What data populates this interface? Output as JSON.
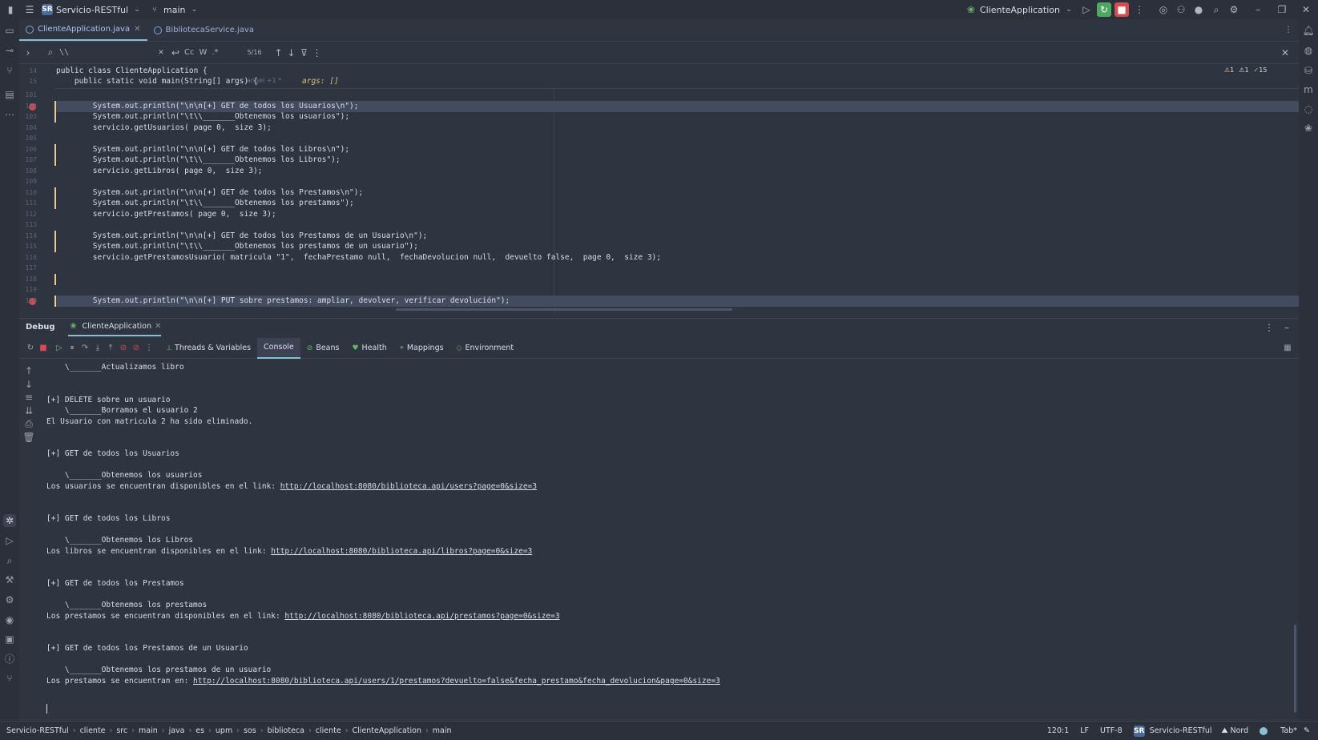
{
  "titlebar": {
    "project_badge": "SR",
    "project_name": "Servicio-RESTful",
    "branch": "main",
    "run_config": "ClienteApplication"
  },
  "tabs": [
    {
      "label": "ClienteApplication.java",
      "active": true
    },
    {
      "label": "BibliotecaService.java",
      "active": false
    }
  ],
  "search": {
    "query": "\\\\",
    "match_case": "Cc",
    "words": "W",
    "regex": ".*",
    "counter": "5/16"
  },
  "inspections": {
    "warnings": "1",
    "weak_warnings": "1",
    "ok": "15"
  },
  "editor": {
    "header_lines": [
      {
        "num": "14",
        "text": "public class ClienteApplication {"
      },
      {
        "num": "15",
        "text": "    public static void main(String[] args) {",
        "author": "angel +1 *",
        "hint": "args: []"
      }
    ],
    "lines": [
      {
        "num": "101",
        "text": ""
      },
      {
        "num": "102",
        "text": "        System.out.println(\"\\n\\n[+] GET de todos los Usuarios\\n\");",
        "bp": true,
        "highlight": true,
        "changed": true
      },
      {
        "num": "103",
        "text": "        System.out.println(\"\\t\\\\_______Obtenemos los usuarios\");",
        "changed": true
      },
      {
        "num": "104",
        "text": "        servicio.getUsuarios( page 0,  size 3);"
      },
      {
        "num": "105",
        "text": ""
      },
      {
        "num": "106",
        "text": "        System.out.println(\"\\n\\n[+] GET de todos los Libros\\n\");",
        "changed": true
      },
      {
        "num": "107",
        "text": "        System.out.println(\"\\t\\\\_______Obtenemos los Libros\");",
        "changed": true
      },
      {
        "num": "108",
        "text": "        servicio.getLibros( page 0,  size 3);"
      },
      {
        "num": "109",
        "text": ""
      },
      {
        "num": "110",
        "text": "        System.out.println(\"\\n\\n[+] GET de todos los Prestamos\\n\");",
        "changed": true
      },
      {
        "num": "111",
        "text": "        System.out.println(\"\\t\\\\_______Obtenemos los prestamos\");",
        "changed": true
      },
      {
        "num": "112",
        "text": "        servicio.getPrestamos( page 0,  size 3);"
      },
      {
        "num": "113",
        "text": ""
      },
      {
        "num": "114",
        "text": "        System.out.println(\"\\n\\n[+] GET de todos los Prestamos de un Usuario\\n\");",
        "changed": true
      },
      {
        "num": "115",
        "text": "        System.out.println(\"\\t\\\\_______Obtenemos los prestamos de un usuario\");",
        "changed": true
      },
      {
        "num": "116",
        "text": "        servicio.getPrestamosUsuario( matricula \"1\",  fechaPrestamo null,  fechaDevolucion null,  devuelto false,  page 0,  size 3);"
      },
      {
        "num": "117",
        "text": ""
      },
      {
        "num": "118",
        "text": "",
        "changed": true
      },
      {
        "num": "119",
        "text": ""
      },
      {
        "num": "120",
        "text": "        System.out.println(\"\\n\\n[+] PUT sobre prestamos: ampliar, devolver, verificar devolución\");",
        "bp": true,
        "highlight": true,
        "changed": true
      }
    ]
  },
  "debug": {
    "title": "Debug",
    "session": "ClienteApplication",
    "tabs": [
      "Threads & Variables",
      "Console",
      "Beans",
      "Health",
      "Mappings",
      "Environment"
    ],
    "active_tab": "Console"
  },
  "console": {
    "lines": [
      {
        "text": "    \\_______Actualizamos libro"
      },
      {
        "text": ""
      },
      {
        "text": ""
      },
      {
        "text": "[+] DELETE sobre un usuario"
      },
      {
        "text": "    \\_______Borramos el usuario 2"
      },
      {
        "text": "El Usuario con matricula 2 ha sido eliminado."
      },
      {
        "text": ""
      },
      {
        "text": ""
      },
      {
        "text": "[+] GET de todos los Usuarios"
      },
      {
        "text": ""
      },
      {
        "text": "    \\_______Obtenemos los usuarios"
      },
      {
        "text": "Los usuarios se encuentran disponibles en el link: ",
        "link": "http://localhost:8080/biblioteca.api/users?page=0&size=3"
      },
      {
        "text": ""
      },
      {
        "text": ""
      },
      {
        "text": "[+] GET de todos los Libros"
      },
      {
        "text": ""
      },
      {
        "text": "    \\_______Obtenemos los Libros"
      },
      {
        "text": "Los libros se encuentran disponibles en el link: ",
        "link": "http://localhost:8080/biblioteca.api/libros?page=0&size=3"
      },
      {
        "text": ""
      },
      {
        "text": ""
      },
      {
        "text": "[+] GET de todos los Prestamos"
      },
      {
        "text": ""
      },
      {
        "text": "    \\_______Obtenemos los prestamos"
      },
      {
        "text": "Los prestamos se encuentran disponibles en el link: ",
        "link": "http://localhost:8080/biblioteca.api/prestamos?page=0&size=3"
      },
      {
        "text": ""
      },
      {
        "text": ""
      },
      {
        "text": "[+] GET de todos los Prestamos de un Usuario"
      },
      {
        "text": ""
      },
      {
        "text": "    \\_______Obtenemos los prestamos de un usuario"
      },
      {
        "text": "Los prestamos se encuentran en: ",
        "link": "http://localhost:8080/biblioteca.api/users/1/prestamos?devuelto=false&fecha_prestamo&fecha_devolucion&page=0&size=3"
      }
    ]
  },
  "statusbar": {
    "breadcrumbs": [
      "Servicio-RESTful",
      "cliente",
      "src",
      "main",
      "java",
      "es",
      "upm",
      "sos",
      "biblioteca",
      "cliente",
      "ClienteApplication",
      "main"
    ],
    "position": "120:1",
    "line_sep": "LF",
    "encoding": "UTF-8",
    "badge": "SR",
    "project": "Servicio-RESTful",
    "theme": "Nord",
    "indent": "Tab*"
  },
  "colors": {
    "background": "#2e3440",
    "accent": "#88c0d0",
    "breakpoint": "#d44b52",
    "change_marker": "#ebcb8b"
  }
}
